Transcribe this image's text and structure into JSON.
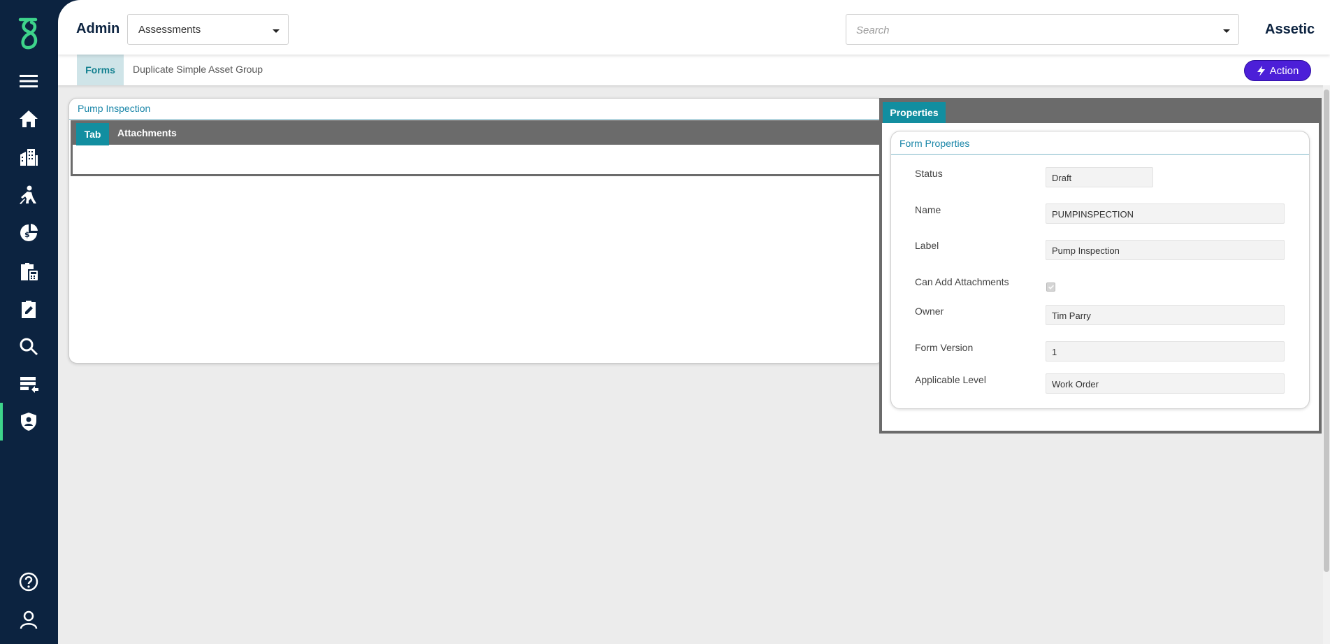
{
  "sidebar": {
    "logo_name": "assetic-logo",
    "items": [
      {
        "name": "menu",
        "icon": "hamburger-menu-icon"
      },
      {
        "name": "home",
        "icon": "home-icon"
      },
      {
        "name": "assets",
        "icon": "buildings-icon"
      },
      {
        "name": "work",
        "icon": "worker-icon"
      },
      {
        "name": "finance",
        "icon": "finance-icon"
      },
      {
        "name": "planning",
        "icon": "clipboard-calculator-icon"
      },
      {
        "name": "assessments",
        "icon": "assessment-icon"
      },
      {
        "name": "search",
        "icon": "search-icon"
      },
      {
        "name": "integration",
        "icon": "data-import-icon"
      },
      {
        "name": "admin",
        "icon": "shield-user-icon",
        "active": true
      }
    ],
    "bottom_items": [
      {
        "name": "help",
        "icon": "help-circle-icon"
      },
      {
        "name": "profile",
        "icon": "user-icon"
      }
    ],
    "accent_color": "#3ed48b",
    "background_color": "#0c2340"
  },
  "header": {
    "title": "Admin",
    "module_select": {
      "value": "Assessments"
    },
    "search": {
      "placeholder": "Search"
    },
    "brand": "Assetic"
  },
  "breadcrumb": {
    "items": [
      "Forms",
      "Duplicate Simple Asset Group"
    ],
    "action_label": "Action",
    "action_color": "#4c1fd8"
  },
  "form_panel": {
    "title": "Pump Inspection",
    "tabs": [
      "Tab",
      "Attachments"
    ]
  },
  "properties": {
    "tab_label": "Properties",
    "card_title": "Form Properties",
    "fields": [
      {
        "label": "Status",
        "value": "Draft"
      },
      {
        "label": "Name",
        "value": "PUMPINSPECTION"
      },
      {
        "label": "Label",
        "value": "Pump Inspection"
      },
      {
        "label": "Can Add Attachments",
        "checked": true
      },
      {
        "label": "Owner",
        "value": "Tim Parry"
      },
      {
        "label": "Form Version",
        "value": "1"
      },
      {
        "label": "Applicable Level",
        "value": "Work Order"
      }
    ]
  }
}
